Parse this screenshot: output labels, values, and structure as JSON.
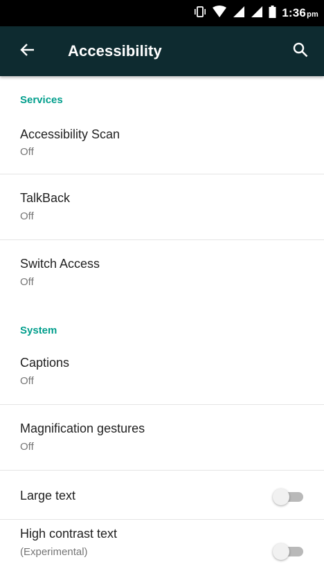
{
  "status_bar": {
    "time": "1:36",
    "ampm": "pm",
    "icons": [
      "vibrate-icon",
      "wifi-icon",
      "signal-icon",
      "signal-icon",
      "battery-icon"
    ]
  },
  "app_bar": {
    "title": "Accessibility",
    "back_icon": "arrow-left-icon",
    "search_icon": "search-icon"
  },
  "colors": {
    "app_bar_bg": "#0e2b30",
    "section_header": "#019e8c",
    "switch_off_track": "#b9b9b9"
  },
  "sections": [
    {
      "header": "Services",
      "items": [
        {
          "title": "Accessibility Scan",
          "summary": "Off"
        },
        {
          "title": "TalkBack",
          "summary": "Off"
        },
        {
          "title": "Switch Access",
          "summary": "Off"
        }
      ]
    },
    {
      "header": "System",
      "items": [
        {
          "title": "Captions",
          "summary": "Off"
        },
        {
          "title": "Magnification gestures",
          "summary": "Off"
        },
        {
          "title": "Large text",
          "toggle": false
        },
        {
          "title": "High contrast text",
          "summary": "(Experimental)",
          "toggle": false
        }
      ]
    }
  ]
}
